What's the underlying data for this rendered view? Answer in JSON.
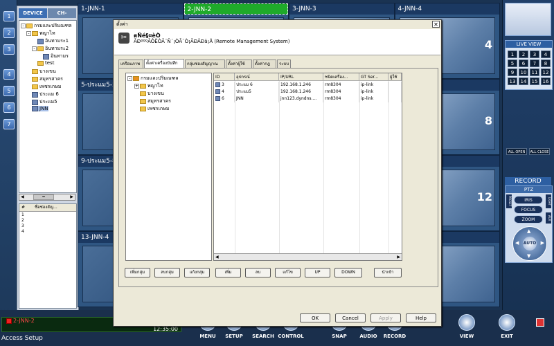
{
  "left_strip": {
    "buttons": [
      "1",
      "2",
      "3",
      "4",
      "5",
      "6",
      "7"
    ]
  },
  "device_panel": {
    "tabs": [
      "DEVICE",
      "CH-GROUP"
    ],
    "tree": [
      {
        "label": "กรมและปริมณฑล",
        "level": 0,
        "type": "folder"
      },
      {
        "label": "พญาไท",
        "level": 1,
        "type": "folder"
      },
      {
        "label": "อินทามระ1",
        "level": 2,
        "type": "cam"
      },
      {
        "label": "อินทามระ2",
        "level": 2,
        "type": "folder"
      },
      {
        "label": "อินทามร",
        "level": 3,
        "type": "cam"
      },
      {
        "label": "test",
        "level": 2,
        "type": "folder"
      },
      {
        "label": "บางเขน",
        "level": 1,
        "type": "folder"
      },
      {
        "label": "สมุทรสาคร",
        "level": 1,
        "type": "folder"
      },
      {
        "label": "เพชรเกษม",
        "level": 1,
        "type": "folder"
      },
      {
        "label": "ประแม 6",
        "level": 1,
        "type": "cam"
      },
      {
        "label": "ประแม5",
        "level": 1,
        "type": "cam"
      },
      {
        "label": "JNN",
        "level": 1,
        "type": "cam"
      }
    ],
    "chan_header": [
      "#",
      "ชื่อช่องสัญ..."
    ],
    "chan_rows": [
      "1",
      "2",
      "3",
      "4"
    ],
    "scroll_symbol": "="
  },
  "grid": {
    "cells": [
      {
        "label": "1-JNN-1",
        "num": ""
      },
      {
        "label": "2-JNN-2",
        "num": "",
        "active": true
      },
      {
        "label": "3-JNN-3",
        "num": ""
      },
      {
        "label": "4-JNN-4",
        "num": "4"
      },
      {
        "label": "5-ประแม5-5",
        "num": ""
      },
      {
        "label": "",
        "num": ""
      },
      {
        "label": "",
        "num": ""
      },
      {
        "label": "",
        "num": "8"
      },
      {
        "label": "9-ประแม5-8",
        "num": ""
      },
      {
        "label": "",
        "num": ""
      },
      {
        "label": "",
        "num": ""
      },
      {
        "label": "",
        "num": "12"
      },
      {
        "label": "13-JNN-4",
        "num": ""
      },
      {
        "label": "",
        "num": ""
      },
      {
        "label": "",
        "num": ""
      },
      {
        "label": "",
        "num": ""
      }
    ]
  },
  "right_panel": {
    "live_view": "LIVE VIEW",
    "numbers": [
      "1",
      "2",
      "3",
      "4",
      "5",
      "6",
      "7",
      "8",
      "9",
      "10",
      "11",
      "12",
      "13",
      "14",
      "15",
      "16"
    ],
    "all_open": "ALL OPEN",
    "all_close": "ALL CLOSE",
    "record": "RECORD",
    "ptz": "PTZ",
    "iris": "IRIS",
    "focus": "FOCUS",
    "zoom": "ZOOM",
    "auto": "AUTO",
    "side_left": "PRESET",
    "side_right": "AUX",
    "light": "LIGHT"
  },
  "status": {
    "channel": "2-JNN-2",
    "time": "12:35:00",
    "access": "Access Setup"
  },
  "toolbar": {
    "buttons": [
      "MENU",
      "SETUP",
      "SEARCH",
      "CONTROL",
      "SNAP",
      "AUDIO",
      "RECORD"
    ],
    "view": "VIEW",
    "exit": "EXIT"
  },
  "dialog": {
    "title": "ตั้งค่า",
    "header_title": "ตÑé§¤èÒ",
    "header_sub": "ÃÐºººÃÔËÒÃ¨Ñ´¡ÒÃ¨Ò¡ÃÐÂÐä¡Å (Remote Management System)",
    "tabs": [
      "เครือมภาพ",
      "ตั้งค่าเครื่องบันทึก",
      "กลุ่มช่องสัญญาณ",
      "ตั้งค่าผู้ใช้",
      "ตั้งค่ากฎ",
      "ระบบ"
    ],
    "tree": [
      {
        "label": "กรมและปริมณฑล",
        "level": 0
      },
      {
        "label": "พญาไท",
        "level": 1
      },
      {
        "label": "บางเขน",
        "level": 1
      },
      {
        "label": "สมุทรสาคร",
        "level": 1
      },
      {
        "label": "เพชรเกษม",
        "level": 1
      }
    ],
    "table": {
      "headers": [
        "ID",
        "อุปกรณ์",
        "IP/URL",
        "ชนิดเครื่อง...",
        "GT Ser...",
        "ผู้ใช้"
      ],
      "rows": [
        [
          "3",
          "ประแม 6",
          "192.168.1.246",
          "rm8304",
          "ip-link",
          ""
        ],
        [
          "4",
          "ประแม5",
          "192.168.1.246",
          "rm8304",
          "ip-link",
          ""
        ],
        [
          "6",
          "JNN",
          "jnn123.dyndns....",
          "rm8304",
          "ip-link",
          ""
        ]
      ]
    },
    "buttons": [
      "เพิ่มกลุ่ม",
      "ลบกลุ่ม",
      "แก้งกลุ่ม",
      "เพิ่ม",
      "ลบ",
      "แก้ไข",
      "UP",
      "DOWN",
      "นำเข้า"
    ],
    "footer": [
      "OK",
      "Cancel",
      "Apply",
      "Help"
    ]
  }
}
